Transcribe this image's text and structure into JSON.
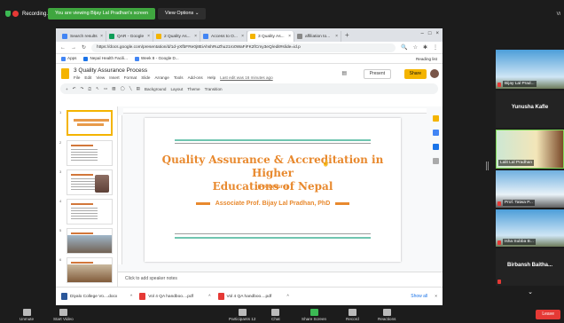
{
  "zoom": {
    "recording": "Recording...",
    "viewing_banner": "You are viewing Bijay Lal Pradhan's screen",
    "view_options": "View Options ⌄",
    "view_label": "Vi",
    "leave": "Leave"
  },
  "browser": {
    "tabs": [
      {
        "label": "Search results",
        "color": "#4285f4"
      },
      {
        "label": "QAR - Google",
        "color": "#0f9d58"
      },
      {
        "label": "2 Quality As...",
        "color": "#f4b400"
      },
      {
        "label": "Access to O...",
        "color": "#4285f4"
      },
      {
        "label": "3 Quality As...",
        "color": "#f4b400"
      },
      {
        "label": "affiliation to...",
        "color": "#888888"
      }
    ],
    "url": "https://docs.google.com/presentation/d/1d-yXfbFRe0j8EiAhshRuZhu21ro0WaFiFK2fCmy3eQ/edit#slide=id.p",
    "bookmarks": [
      "Apps",
      "Nepal Health Facili...",
      "Week 8 - Google D..."
    ],
    "reading_list": "Reading list"
  },
  "slides": {
    "doc_title": "3 Quality Assurance Process",
    "menus": [
      "File",
      "Edit",
      "View",
      "Insert",
      "Format",
      "Slide",
      "Arrange",
      "Tools",
      "Add-ons",
      "Help"
    ],
    "last_edit": "Last edit was 16 minutes ago",
    "present": "Present",
    "share": "Share",
    "toolbar": [
      "Background",
      "Layout",
      "Theme",
      "Transition"
    ],
    "speaker_notes": "Click to add speaker notes",
    "explore": "Explore",
    "thumb_numbers": [
      "1",
      "2",
      "3",
      "4",
      "5",
      "6"
    ]
  },
  "slide": {
    "title_line1": "Quality Assurance & Accreditation in Higher",
    "title_line2": "Educations of Nepal",
    "subtitle": "(Procedure)",
    "author": "Associate Prof. Bijay Lal Pradhan, PhD"
  },
  "downloads": {
    "items": [
      "Diyalo College Vo....docx",
      "Vol 4 QA handboo....pdf",
      "Vol 4 QA handboo....pdf"
    ],
    "show_all": "Show all"
  },
  "participants": [
    "Bijay Lal Prad...",
    "Yunusha Kafle",
    "Lalit Lal Pradhan",
    "Prof. Tatwa P...",
    "Isha Subba B...",
    "Birbansh Baitha..."
  ],
  "zoom_bottom": [
    "Unmute",
    "Start Video",
    "Participants",
    "Chat",
    "Share Screen",
    "Record",
    "Reactions"
  ],
  "participant_count": "12"
}
